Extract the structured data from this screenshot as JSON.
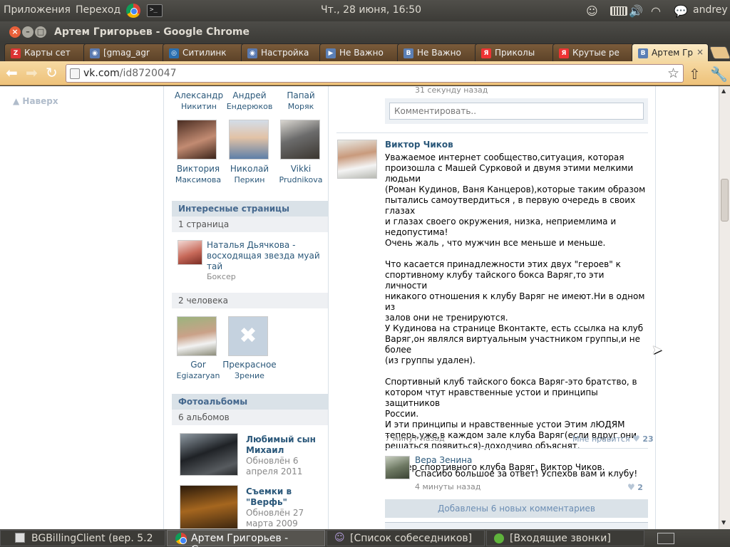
{
  "panel": {
    "apps": "Приложения",
    "places": "Переход",
    "clock": "Чт., 28 июня, 16:50",
    "user": "andrey"
  },
  "window": {
    "title": "Артем Григорьев - Google Chrome"
  },
  "tabs": [
    {
      "label": "Карты сет",
      "icon": "Z",
      "color": "#d33"
    },
    {
      "label": "[gmag_agr",
      "icon": "◉",
      "color": "#5a7ab0"
    },
    {
      "label": "Ситилинк",
      "icon": "◎",
      "color": "#2a6fb0"
    },
    {
      "label": "Настройка",
      "icon": "◉",
      "color": "#5a7ab0"
    },
    {
      "label": "Не Важно",
      "icon": "▶",
      "color": "#5b7fb5"
    },
    {
      "label": "Не Важно",
      "icon": "В",
      "color": "#5b7fb5"
    },
    {
      "label": "Приколы",
      "icon": "Я",
      "color": "#e33"
    },
    {
      "label": "Крутые ре",
      "icon": "Я",
      "color": "#e33"
    },
    {
      "label": "Артем Гри",
      "icon": "В",
      "color": "#5b7fb5",
      "active": true
    }
  ],
  "toolbar": {
    "url_host": "vk.com",
    "url_path": "/id8720047"
  },
  "page": {
    "back_to_top": "Наверх",
    "friends_top": [
      {
        "first": "Александр",
        "last": "Никитин"
      },
      {
        "first": "Андрей",
        "last": "Ендерюков"
      },
      {
        "first": "Папай",
        "last": "Моряк"
      }
    ],
    "friends_second": [
      {
        "first": "Виктория",
        "last": "Максимова"
      },
      {
        "first": "Николай",
        "last": "Перкин"
      },
      {
        "first": "Vikki",
        "last": "Prudnikova"
      }
    ],
    "interesting_pages": {
      "header": "Интересные страницы",
      "count": "1 страница",
      "item_title": "Наталья Дьячкова - восходящая звезда муай тай",
      "item_sub": "Боксер",
      "people_count": "2 человека",
      "people": [
        {
          "first": "Gor",
          "last": "Egiazaryan"
        },
        {
          "first": "Прекрасное",
          "last": "Зрение"
        }
      ]
    },
    "albums": {
      "header": "Фотоальбомы",
      "count": "6 альбомов",
      "items": [
        {
          "title": "Любимый сын Михаил",
          "updated": "Обновлён 6 апреля 2011"
        },
        {
          "title": "Съемки в \"Верфь\"",
          "updated": "Обновлён 27 марта 2009"
        }
      ]
    },
    "wall": {
      "prev_time": "31 секунду назад",
      "comment_placeholder": "Комментировать..",
      "post_author": "Виктор Чиков",
      "post_text": "Уважаемое интернет сообщество,ситуация, которая\nпроизошла с Машей Сурковой и двумя этими мелкими\nлюдьми\n(Роман Кудинов, Ваня Канцеров),которые таким образом\nпытались самоутвердиться , в первую очередь в своих глазах\nи глазах своего окружения, низка, неприемлима и\nнедопустима!\nОчень жаль , что мужчин все меньше и меньше.\n\nЧто касается принадлежности этих двух \"героев\" к\nспортивному клубу тайского бокса Варяг,то эти личности\nникакого отношения к клубу Варяг не имеют.Ни в одном из\nзалов они не тренируются.\nУ Кудинова на странице Вконтакте, есть ссылка на клуб\nВаряг,он являлся виртуальным участником группы,и не\nболее\n(из группы удален).\n\nСпортивный клуб тайского бокса Варяг-это братство, в\nкотором чтут нравственные устои и принципы защитников\nРоссии.\nИ эти принципы и нравственные устои Этим лЮДЯМ\nтеперь,уже,в каждом зале клуба Варяг(если вдруг они\nрешаться появиться)-доходчиво объяснят.\n\nТренер спортивного клуба Варяг, Виктор Чиков.",
      "post_time": "7 минут назад",
      "like_label": "Мне нравится",
      "like_count": "23",
      "reply_author": "Вера Зенина",
      "reply_text": "Спасибо большое за ответ! Успехов вам и клубу!",
      "reply_time": "4 минуты назад",
      "reply_likes": "2",
      "new_comments": "Добавлены 6 новых комментариев"
    }
  },
  "taskbar": [
    {
      "label": "BGBillingClient (вер. 5.2 ..."
    },
    {
      "label": "Артем Григорьев - Goog..."
    },
    {
      "label": "[Список собеседников]"
    },
    {
      "label": "[Входящие звонки]"
    }
  ],
  "colors": {
    "vk_link": "#2b587a",
    "vk_header_bg": "#dae2e8",
    "tab_bg": "#5c4228",
    "toolbar_bg": "#eec27a"
  }
}
